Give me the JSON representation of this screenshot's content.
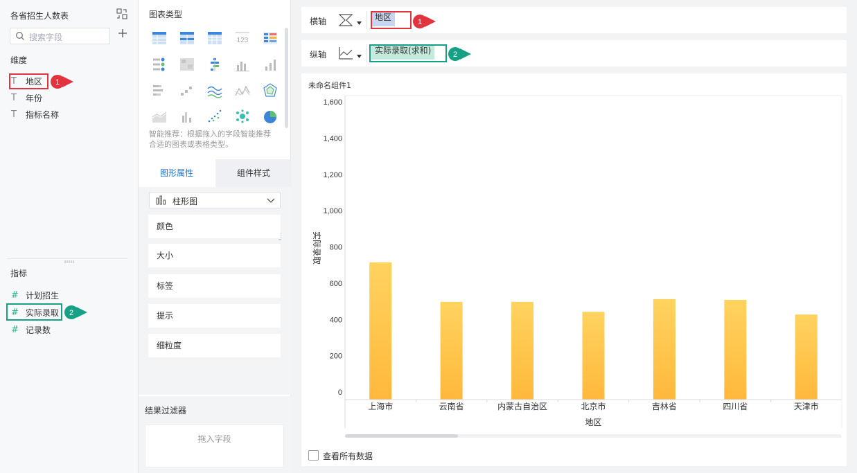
{
  "left": {
    "title": "各省招生人数表",
    "search_placeholder": "搜索字段",
    "dimensions_label": "维度",
    "dimensions": [
      "地区",
      "年份",
      "指标名称"
    ],
    "measures_label": "指标",
    "measures": [
      "计划招生",
      "实际录取",
      "记录数"
    ]
  },
  "middle": {
    "chart_types_label": "图表类型",
    "hint": "智能推荐：根据拖入的字段智能推荐合适的图表或表格类型。",
    "tab_properties": "图形属性",
    "tab_style": "组件样式",
    "chart_select": "柱形图",
    "props": [
      "颜色",
      "大小",
      "标签",
      "提示",
      "细粒度"
    ],
    "filter_title": "结果过滤器",
    "filter_drop": "拖入字段"
  },
  "axes": {
    "x_label": "横轴",
    "x_field": "地区",
    "y_label": "纵轴",
    "y_field": "实际录取(求和)"
  },
  "badges": {
    "one": "1",
    "two": "2"
  },
  "component_title": "未命名组件1",
  "view_all": "查看所有数据",
  "colors": {
    "bar_top": "#ffd35f",
    "bar_bottom": "#ffb83c",
    "red": "#e2343f",
    "green": "#16a085",
    "accent": "#1f78d1"
  },
  "chart_data": {
    "type": "bar",
    "categories": [
      "上海市",
      "云南省",
      "内蒙古自治区",
      "北京市",
      "吉林省",
      "四川省",
      "天津市"
    ],
    "values": [
      715,
      497,
      497,
      442,
      512,
      508,
      427
    ],
    "xlabel": "地区",
    "ylabel": "实际录取",
    "ylim": [
      0,
      1600
    ],
    "yticks": [
      0,
      200,
      400,
      600,
      800,
      1000,
      1200,
      1400,
      1600
    ],
    "ytick_labels": [
      "0",
      "200",
      "400",
      "600",
      "800",
      "1,000",
      "1,200",
      "1,400",
      "1,600"
    ],
    "grid": false
  }
}
